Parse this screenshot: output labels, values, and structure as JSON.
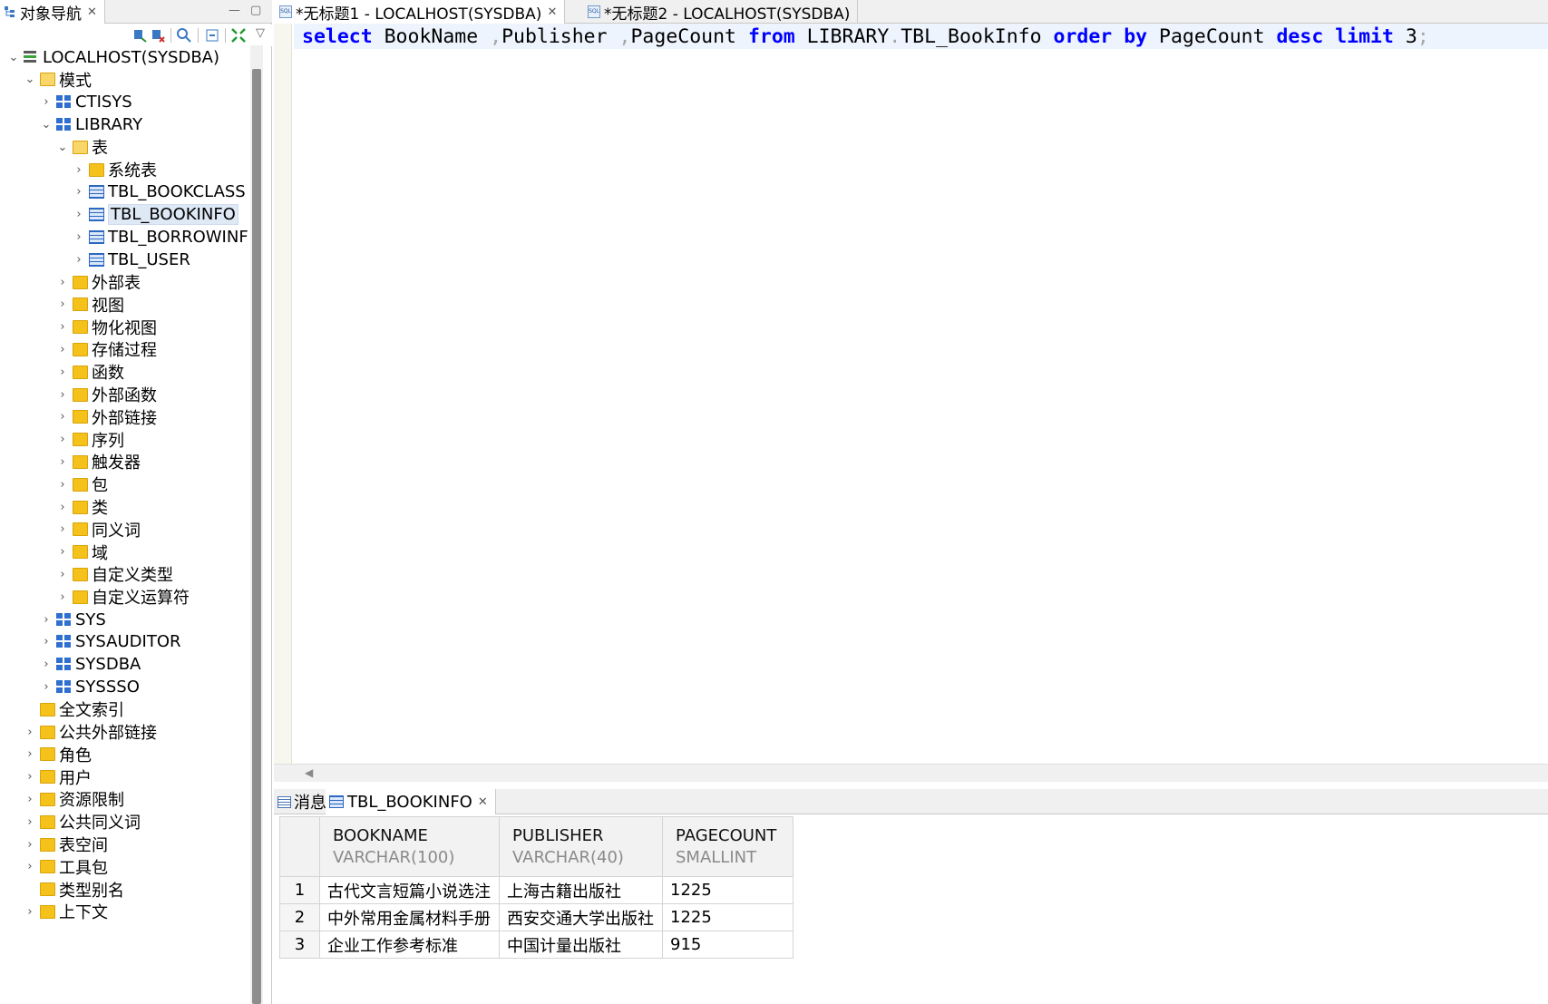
{
  "navigator": {
    "tab_title": "对象导航",
    "root": "LOCALHOST(SYSDBA)",
    "tree": [
      {
        "label": "模式",
        "type": "folder",
        "expanded": true,
        "level": 1
      },
      {
        "label": "CTISYS",
        "type": "schema",
        "expanded": false,
        "level": 2
      },
      {
        "label": "LIBRARY",
        "type": "schema",
        "expanded": true,
        "level": 2
      },
      {
        "label": "表",
        "type": "folder",
        "expanded": true,
        "level": 3
      },
      {
        "label": "系统表",
        "type": "folder",
        "expanded": false,
        "level": 4
      },
      {
        "label": "TBL_BOOKCLASS",
        "type": "table",
        "expanded": false,
        "level": 4
      },
      {
        "label": "TBL_BOOKINFO",
        "type": "table",
        "expanded": false,
        "level": 4,
        "selected": true
      },
      {
        "label": "TBL_BORROWINF",
        "type": "table",
        "expanded": false,
        "level": 4
      },
      {
        "label": "TBL_USER",
        "type": "table",
        "expanded": false,
        "level": 4
      },
      {
        "label": "外部表",
        "type": "folder",
        "expanded": false,
        "level": 3
      },
      {
        "label": "视图",
        "type": "folder",
        "expanded": false,
        "level": 3
      },
      {
        "label": "物化视图",
        "type": "folder",
        "expanded": false,
        "level": 3
      },
      {
        "label": "存储过程",
        "type": "folder",
        "expanded": false,
        "level": 3
      },
      {
        "label": "函数",
        "type": "folder",
        "expanded": false,
        "level": 3
      },
      {
        "label": "外部函数",
        "type": "folder",
        "expanded": false,
        "level": 3
      },
      {
        "label": "外部链接",
        "type": "folder",
        "expanded": false,
        "level": 3
      },
      {
        "label": "序列",
        "type": "folder",
        "expanded": false,
        "level": 3
      },
      {
        "label": "触发器",
        "type": "folder",
        "expanded": false,
        "level": 3
      },
      {
        "label": "包",
        "type": "folder",
        "expanded": false,
        "level": 3
      },
      {
        "label": "类",
        "type": "folder",
        "expanded": false,
        "level": 3
      },
      {
        "label": "同义词",
        "type": "folder",
        "expanded": false,
        "level": 3
      },
      {
        "label": "域",
        "type": "folder",
        "expanded": false,
        "level": 3
      },
      {
        "label": "自定义类型",
        "type": "folder",
        "expanded": false,
        "level": 3
      },
      {
        "label": "自定义运算符",
        "type": "folder",
        "expanded": false,
        "level": 3
      },
      {
        "label": "SYS",
        "type": "schema",
        "expanded": false,
        "level": 2
      },
      {
        "label": "SYSAUDITOR",
        "type": "schema",
        "expanded": false,
        "level": 2
      },
      {
        "label": "SYSDBA",
        "type": "schema",
        "expanded": false,
        "level": 2
      },
      {
        "label": "SYSSSO",
        "type": "schema",
        "expanded": false,
        "level": 2
      },
      {
        "label": "全文索引",
        "type": "folder",
        "expanded": false,
        "level": 1,
        "leaf": true
      },
      {
        "label": "公共外部链接",
        "type": "folder",
        "expanded": false,
        "level": 1
      },
      {
        "label": "角色",
        "type": "folder",
        "expanded": false,
        "level": 1
      },
      {
        "label": "用户",
        "type": "folder",
        "expanded": false,
        "level": 1
      },
      {
        "label": "资源限制",
        "type": "folder",
        "expanded": false,
        "level": 1
      },
      {
        "label": "公共同义词",
        "type": "folder",
        "expanded": false,
        "level": 1
      },
      {
        "label": "表空间",
        "type": "folder",
        "expanded": false,
        "level": 1
      },
      {
        "label": "工具包",
        "type": "folder",
        "expanded": false,
        "level": 1
      },
      {
        "label": "类型别名",
        "type": "folder",
        "expanded": false,
        "level": 1,
        "leaf": true
      },
      {
        "label": "上下文",
        "type": "folder",
        "expanded": false,
        "level": 1
      }
    ]
  },
  "editor": {
    "tabs": [
      {
        "label": "*无标题1 - LOCALHOST(SYSDBA)",
        "active": true
      },
      {
        "label": "*无标题2 - LOCALHOST(SYSDBA)",
        "active": false
      }
    ],
    "sql_tokens": [
      {
        "t": "select",
        "k": "kw"
      },
      {
        "t": " BookName ",
        "k": ""
      },
      {
        "t": ",",
        "k": "punc"
      },
      {
        "t": "Publisher ",
        "k": ""
      },
      {
        "t": ",",
        "k": "punc"
      },
      {
        "t": "PageCount ",
        "k": ""
      },
      {
        "t": "from",
        "k": "kw"
      },
      {
        "t": " LIBRARY",
        "k": ""
      },
      {
        "t": ".",
        "k": "punc"
      },
      {
        "t": "TBL_BookInfo ",
        "k": ""
      },
      {
        "t": "order",
        "k": "kw"
      },
      {
        "t": " ",
        "k": ""
      },
      {
        "t": "by",
        "k": "kw"
      },
      {
        "t": " PageCount ",
        "k": ""
      },
      {
        "t": "desc",
        "k": "kw"
      },
      {
        "t": " ",
        "k": ""
      },
      {
        "t": "limit",
        "k": "kw"
      },
      {
        "t": " 3",
        "k": ""
      },
      {
        "t": ";",
        "k": "punc"
      }
    ]
  },
  "results": {
    "tabs": [
      {
        "label": "消息",
        "icon": "message-icon",
        "active": false
      },
      {
        "label": "TBL_BOOKINFO",
        "icon": "table-icon",
        "active": true
      }
    ],
    "columns": [
      {
        "name": "BOOKNAME",
        "type": "VARCHAR(100)"
      },
      {
        "name": "PUBLISHER",
        "type": "VARCHAR(40)"
      },
      {
        "name": "PAGECOUNT",
        "type": "SMALLINT"
      }
    ],
    "rows": [
      {
        "n": "1",
        "cells": [
          "古代文言短篇小说选注",
          "上海古籍出版社",
          "1225"
        ]
      },
      {
        "n": "2",
        "cells": [
          "中外常用金属材料手册",
          "西安交通大学出版社",
          "1225"
        ]
      },
      {
        "n": "3",
        "cells": [
          "企业工作参考标准",
          "中国计量出版社",
          "915"
        ]
      }
    ]
  },
  "colors": {
    "keyword": "#0000ff",
    "selection": "#dfe9f6",
    "current_line": "#eef4fd"
  }
}
